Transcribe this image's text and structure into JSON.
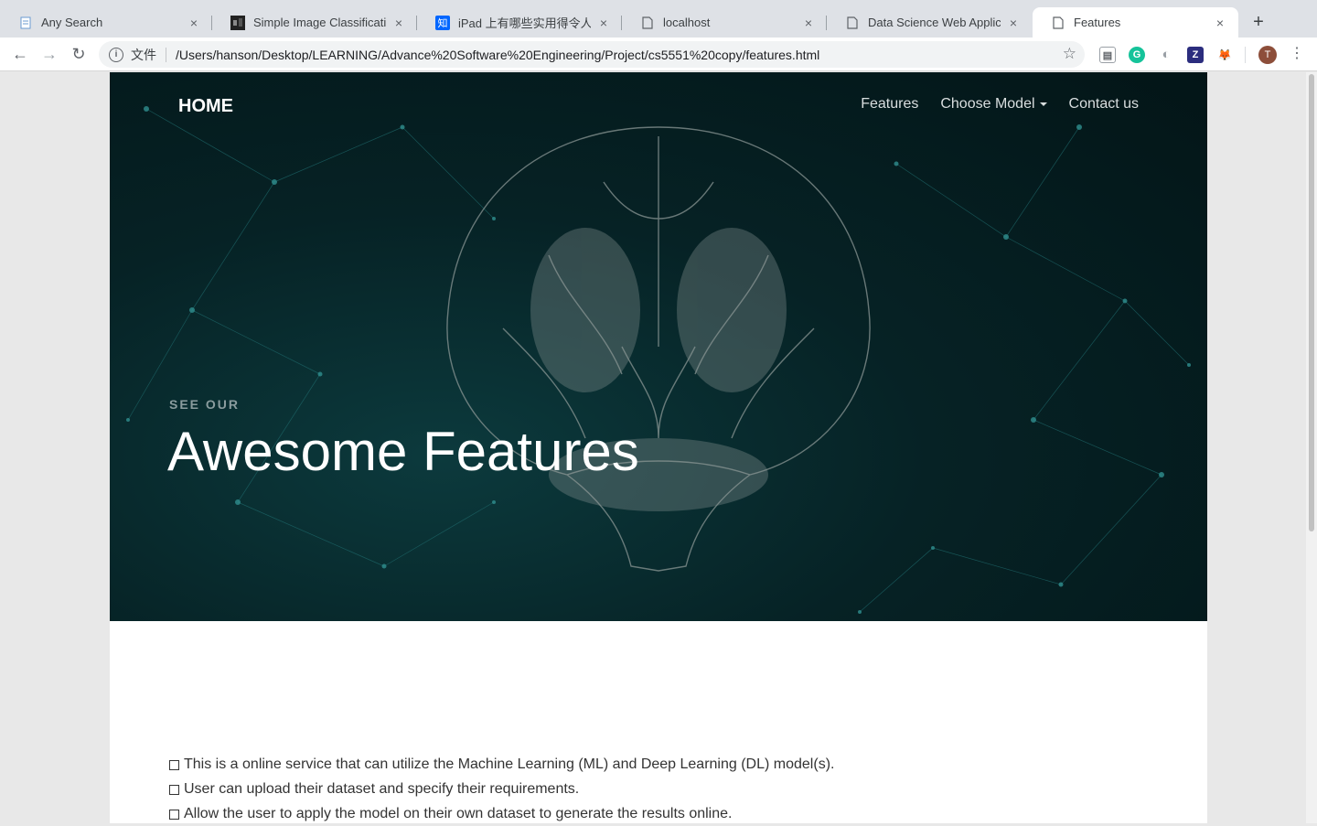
{
  "tabs": [
    {
      "title": "Any Search",
      "icon": "doc-icon",
      "close": "×"
    },
    {
      "title": "Simple Image Classification",
      "icon": "image-icon",
      "close": "×"
    },
    {
      "title": "iPad 上有哪些实用得令人惊艳",
      "icon": "zhihu-icon",
      "close": "×"
    },
    {
      "title": "localhost",
      "icon": "page-icon",
      "close": "×"
    },
    {
      "title": "Data Science Web Applicatio",
      "icon": "page-icon",
      "close": "×"
    },
    {
      "title": "Features",
      "icon": "page-icon",
      "close": "×"
    }
  ],
  "newtab_label": "+",
  "zhihu_glyph": "知",
  "toolbar": {
    "back": "←",
    "forward": "→",
    "reload": "↻",
    "info_glyph": "i",
    "scheme": "文件",
    "url": "/Users/hanson/Desktop/LEARNING/Advance%20Software%20Engineering/Project/cs5551%20copy/features.html",
    "star": "☆",
    "menu": "⋮"
  },
  "extensions": [
    {
      "name": "reader-icon",
      "glyph": "▤",
      "color": "#9aa0a6"
    },
    {
      "name": "grammarly-icon",
      "glyph": "G",
      "color": "#15c39a"
    },
    {
      "name": "sync-icon",
      "glyph": "◐",
      "color": "#9aa0a6"
    },
    {
      "name": "zotero-icon",
      "glyph": "Z",
      "color": "#2b2d7e"
    },
    {
      "name": "metamask-icon",
      "glyph": "🦊",
      "color": "#ffffff"
    }
  ],
  "profile_initial": "T",
  "site": {
    "home_label": "HOME",
    "nav": {
      "features": "Features",
      "choose_model": "Choose Model",
      "contact": "Contact us"
    },
    "kicker": "SEE OUR",
    "headline": "Awesome Features"
  },
  "features": [
    "This is a online service that can utilize the Machine Learning (ML) and Deep Learning (DL) model(s).",
    "User can upload their dataset and specify their requirements.",
    "Allow the user to apply the model on their own dataset to generate the results online."
  ]
}
